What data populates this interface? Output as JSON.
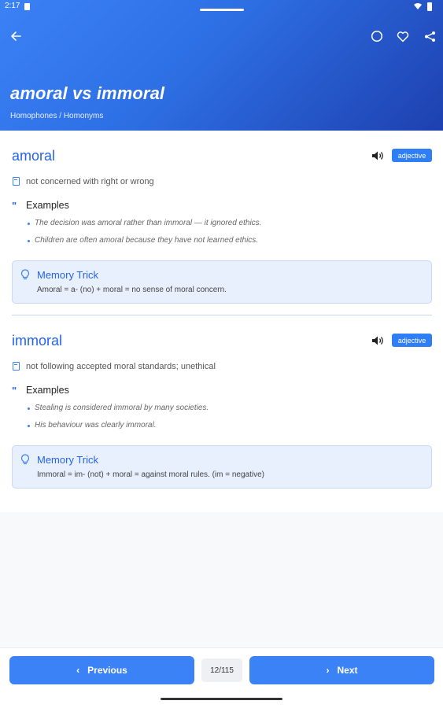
{
  "status_bar": {
    "time": "2:17"
  },
  "header": {
    "title": "amoral vs immoral",
    "subtitle": "Homophones / Homonyms"
  },
  "words": [
    {
      "word": "amoral",
      "part_of_speech": "adjective",
      "definition": "not concerned with right or wrong",
      "examples_label": "Examples",
      "examples": [
        "The decision was amoral rather than immoral — it ignored ethics.",
        "Children are often amoral because they have not learned ethics."
      ],
      "memory_trick_label": "Memory Trick",
      "memory_trick": "Amoral = a- (no) + moral = no sense of moral concern."
    },
    {
      "word": "immoral",
      "part_of_speech": "adjective",
      "definition": "not following accepted moral standards; unethical",
      "examples_label": "Examples",
      "examples": [
        "Stealing is considered immoral by many societies.",
        "His behaviour was clearly immoral."
      ],
      "memory_trick_label": "Memory Trick",
      "memory_trick": "Immoral = im- (not) + moral = against moral rules. (im = negative)"
    }
  ],
  "navigation": {
    "previous_label": "Previous",
    "next_label": "Next",
    "counter": "12/115"
  },
  "icons": {
    "back": "arrow-left-icon",
    "circle": "circle-icon",
    "favorite": "heart-icon",
    "share": "share-icon",
    "speaker": "speaker-icon",
    "definition": "book-icon",
    "examples": "quote-icon",
    "memory_trick": "lightbulb-icon"
  },
  "colors": {
    "accent": "#3b82f6",
    "header_start": "#3b82f6",
    "header_end": "#1e40af",
    "trick_bg": "#e8f0fd"
  }
}
